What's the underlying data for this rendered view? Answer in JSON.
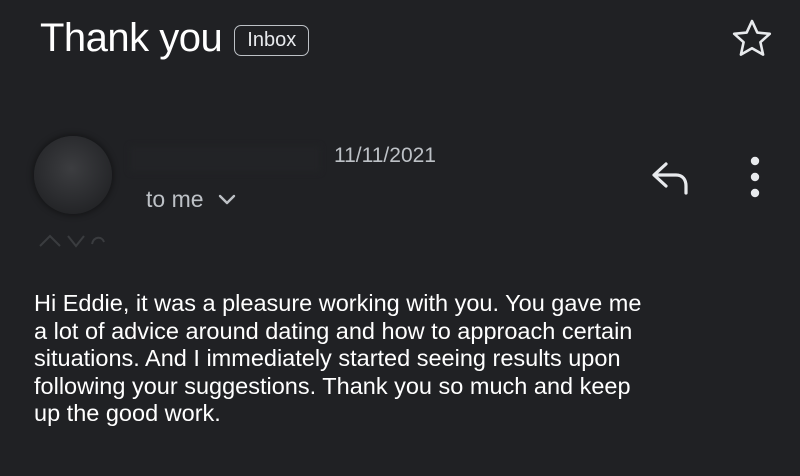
{
  "email": {
    "subject": "Thank you",
    "label": "Inbox",
    "date": "11/11/2021",
    "recipient": "to me",
    "body_lines": [
      "Hi Eddie, it was a pleasure working with you. You  gave me",
      "a lot of advice around dating and how to approach certain",
      "situations. And I immediately started seeing results upon",
      "following your suggestions. Thank you so much and keep",
      "up the good work."
    ]
  },
  "icons": {
    "star": "star-icon",
    "reply": "reply-icon",
    "more": "more-vert-icon",
    "expand": "chevron-down-icon"
  },
  "colors": {
    "background": "#202124",
    "text": "#ffffff",
    "secondary_text": "#bdc1c6"
  }
}
